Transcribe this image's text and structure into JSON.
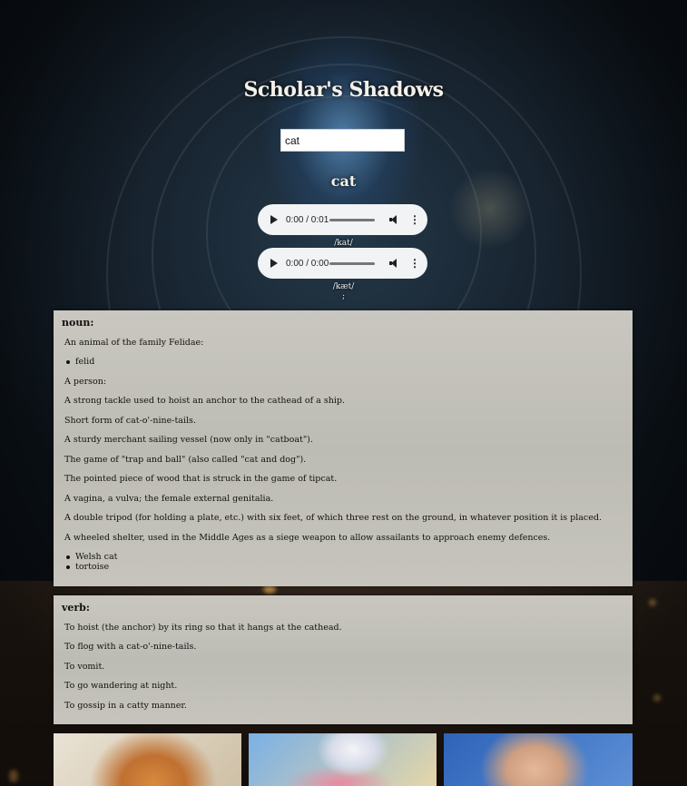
{
  "app": {
    "title": "Scholar's Shadows"
  },
  "search": {
    "value": "cat",
    "placeholder": ""
  },
  "entry": {
    "word": "cat",
    "pronunciations": [
      {
        "time": "0:00 / 0:01",
        "phonetic": "/kat/"
      },
      {
        "time": "0:00 / 0:00",
        "phonetic": "/kæt/"
      }
    ],
    "separator": ";"
  },
  "meanings": [
    {
      "part_of_speech": "noun:",
      "definitions": [
        "An animal of the family Felidae:",
        "A person:",
        "A strong tackle used to hoist an anchor to the cathead of a ship.",
        "Short form of cat-o'-nine-tails.",
        "A sturdy merchant sailing vessel (now only in \"catboat\").",
        "The game of \"trap and ball\" (also called \"cat and dog\").",
        "The pointed piece of wood that is struck in the game of tipcat.",
        "A vagina, a vulva; the female external genitalia.",
        "A double tripod (for holding a plate, etc.) with six feet, of which three rest on the ground, in whatever position it is placed.",
        "A wheeled shelter, used in the Middle Ages as a siege weapon to allow assailants to approach enemy defences."
      ],
      "synonyms_after_first": [
        "felid"
      ],
      "related": [
        "Welsh cat",
        "tortoise"
      ]
    },
    {
      "part_of_speech": "verb:",
      "definitions": [
        "To hoist (the anchor) by its ring so that it hangs at the cathead.",
        "To flog with a cat-o'-nine-tails.",
        "To vomit.",
        "To go wandering at night.",
        "To gossip in a catty manner."
      ]
    }
  ],
  "images": [
    {
      "alt": "orange tabby cat"
    },
    {
      "alt": "white cat with flowers"
    },
    {
      "alt": "cream cat on blue background"
    }
  ],
  "icons": {
    "play": "play-icon",
    "volume": "volume-icon",
    "more": "more-vert-icon"
  }
}
